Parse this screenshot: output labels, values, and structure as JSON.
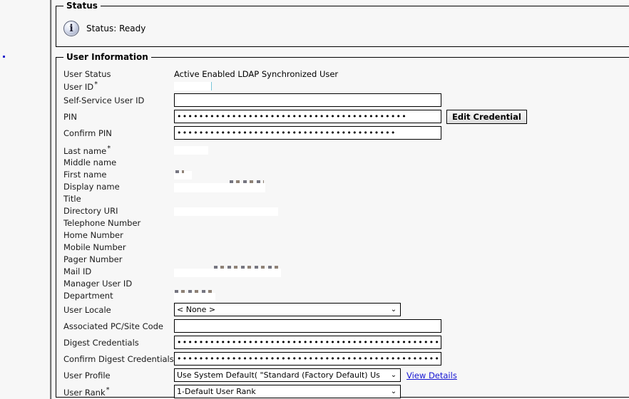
{
  "status_panel": {
    "legend": "Status",
    "icon": "info-icon",
    "text": "Status: Ready"
  },
  "user_information": {
    "legend": "User Information",
    "fields": {
      "user_status": {
        "label": "User Status",
        "value": "Active Enabled LDAP Synchronized User"
      },
      "user_id": {
        "label": "User ID",
        "required": "*",
        "value": "",
        "redacted": true
      },
      "self_service_user_id": {
        "label": "Self-Service User ID",
        "value": "",
        "placeholder": ""
      },
      "pin": {
        "label": "PIN",
        "value": "••••••••••••••••••••••••••••••••••••••••••"
      },
      "confirm_pin": {
        "label": "Confirm PIN",
        "value": "••••••••••••••••••••••••••••••••••••••••"
      },
      "last_name": {
        "label": "Last name",
        "required": "*",
        "value": "",
        "redacted": true
      },
      "middle_name": {
        "label": "Middle name",
        "value": ""
      },
      "first_name": {
        "label": "First name",
        "value": "",
        "redacted": true
      },
      "display_name": {
        "label": "Display name",
        "value": "",
        "redacted": true
      },
      "title": {
        "label": "Title",
        "value": ""
      },
      "directory_uri": {
        "label": "Directory URI",
        "value": "",
        "redacted": true
      },
      "telephone_number": {
        "label": "Telephone Number",
        "value": ""
      },
      "home_number": {
        "label": "Home Number",
        "value": ""
      },
      "mobile_number": {
        "label": "Mobile Number",
        "value": ""
      },
      "pager_number": {
        "label": "Pager Number",
        "value": ""
      },
      "mail_id": {
        "label": "Mail ID",
        "value": "",
        "redacted": true
      },
      "manager_user_id": {
        "label": "Manager User ID",
        "value": ""
      },
      "department": {
        "label": "Department",
        "value": "",
        "redacted": true
      },
      "user_locale": {
        "label": "User Locale",
        "value": "< None >"
      },
      "associated_pc_site_code": {
        "label": "Associated PC/Site Code",
        "value": ""
      },
      "digest_credentials": {
        "label": "Digest Credentials",
        "value": "•••••••••••••••••••••••••••••••••••••••••••••••••••••"
      },
      "confirm_digest_credentials": {
        "label": "Confirm Digest Credentials",
        "value": "•••••••••••••••••••••••••••••••••••••••••••••••••••••"
      },
      "user_profile": {
        "label": "User Profile",
        "value": "Use System Default( \"Standard (Factory Default) Us"
      },
      "user_rank": {
        "label": "User Rank",
        "required": "*",
        "value": "1-Default User Rank"
      }
    },
    "buttons": {
      "edit_credential": "Edit Credential"
    },
    "links": {
      "view_details": "View Details"
    },
    "caret_glyph": "⌄"
  }
}
